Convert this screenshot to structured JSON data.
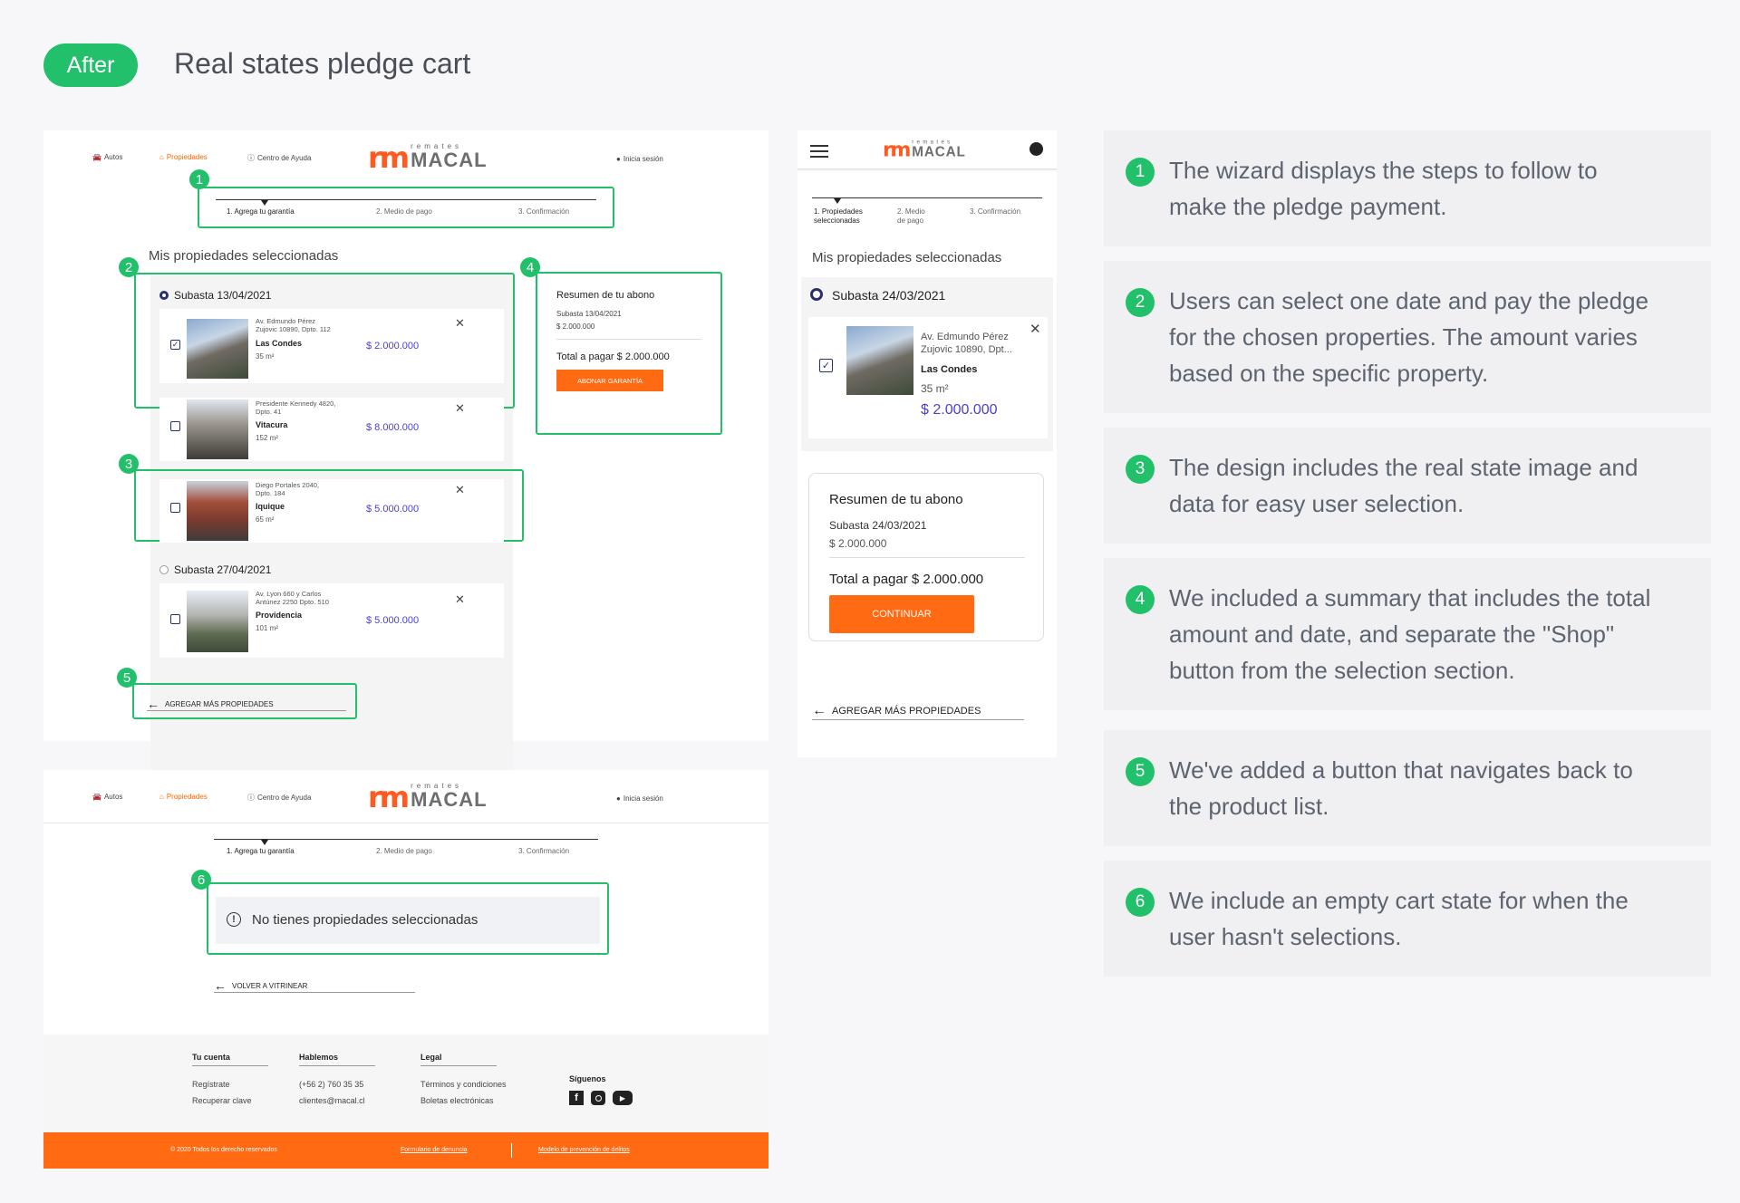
{
  "header": {
    "badge": "After",
    "title": "Real states pledge cart"
  },
  "nav": {
    "autos": "Autos",
    "propiedades": "Propiedades",
    "ayuda": "Centro de Ayuda",
    "login": "Inicia sesión",
    "logo_small": "remates",
    "logo_big": "MACAL",
    "logo_mark": "rm"
  },
  "steps": {
    "desktop": [
      "1. Agrega tu garantía",
      "2. Medio de pago",
      "3. Confirmación"
    ],
    "mobile": [
      [
        "1. Propiedades",
        "seleccionadas"
      ],
      [
        "2. Medio",
        "de pago"
      ],
      [
        "3. Confirmación"
      ]
    ]
  },
  "badges": [
    "1",
    "2",
    "3",
    "4",
    "5",
    "6"
  ],
  "desktop": {
    "section_title": "Mis propiedades seleccionadas",
    "auctions": [
      {
        "label": "Subasta 13/04/2021",
        "items": [
          {
            "addr1": "Av. Edmundo Pérez",
            "addr2": "Zujovic 10890, Dpto. 112",
            "city": "Las Condes",
            "area": "35 m²",
            "price": "$ 2.000.000",
            "checked": true
          },
          {
            "addr1": "Presidente Kennedy 4820,",
            "addr2": "Dpto. 41",
            "city": "Vitacura",
            "area": "152 m²",
            "price": "$ 8.000.000",
            "checked": false
          },
          {
            "addr1": "Diego Portales 2040,",
            "addr2": "Dpto. 184",
            "city": "Iquique",
            "area": "65 m²",
            "price": "$ 5.000.000",
            "checked": false
          }
        ]
      },
      {
        "label": "Subasta 27/04/2021",
        "items": [
          {
            "addr1": "Av. Lyon 660 y Carlos",
            "addr2": "Antúnez 2250 Dpto. 510",
            "city": "Providencia",
            "area": "101 m²",
            "price": "$ 5.000.000",
            "checked": false
          }
        ]
      }
    ],
    "summary": {
      "title": "Resumen de tu abono",
      "auction": "Subasta 13/04/2021",
      "amount": "$ 2.000.000",
      "total": "Total a pagar $ 2.000.000",
      "button": "ABONAR GARANTÍA"
    },
    "add_more": "AGREGAR MÁS PROPIEDADES"
  },
  "empty": {
    "message": "No tienes propiedades seleccionadas",
    "back": "VOLVER A VITRINEAR"
  },
  "footer": {
    "cols": [
      {
        "head": "Tu cuenta",
        "items": [
          "Regístrate",
          "Recuperar clave"
        ]
      },
      {
        "head": "Hablemos",
        "items": [
          "(+56 2) 760 35 35",
          "clientes@macal.cl"
        ]
      },
      {
        "head": "Legal",
        "items": [
          "Términos y condiciones",
          "Boletas  electrónicas"
        ]
      }
    ],
    "follow": "Síguenos",
    "copyright": "2020 Todos los derecho reservados",
    "link1": "Formulario de denuncia",
    "link2": "Modelo de prevención de delitos"
  },
  "mobile": {
    "section_title": "Mis propiedades seleccionadas",
    "auction": "Subasta 24/03/2021",
    "item": {
      "addr1": "Av. Edmundo Pérez",
      "addr2": "Zujovic 10890, Dpt...",
      "city": "Las Condes",
      "area": "35 m²",
      "price": "$ 2.000.000"
    },
    "summary": {
      "title": "Resumen de tu abono",
      "auction": "Subasta 24/03/2021",
      "amount": "$ 2.000.000",
      "total": "Total a pagar $ 2.000.000",
      "button": "CONTINUAR"
    },
    "add_more": "AGREGAR MÁS PROPIEDADES"
  },
  "notes": [
    {
      "n": "1",
      "lines": [
        "The wizard displays the steps to follow to",
        "make the pledge payment."
      ]
    },
    {
      "n": "2",
      "lines": [
        "Users can select one date and pay the pledge",
        "for the chosen properties. The amount varies",
        "based on the specific property."
      ]
    },
    {
      "n": "3",
      "lines": [
        "The design includes the real state image and",
        "data for easy user selection."
      ]
    },
    {
      "n": "4",
      "lines": [
        "We included a summary that includes the total",
        "amount and date, and separate the \"Shop\"",
        "button from the selection section."
      ]
    },
    {
      "n": "5",
      "lines": [
        "We've added a button that navigates back to",
        "the product list."
      ]
    },
    {
      "n": "6",
      "lines": [
        "We include an empty cart state for when the",
        "user hasn't selections."
      ]
    }
  ],
  "colors": {
    "accent_green": "#22c06a",
    "brand_orange": "#ff6a13",
    "price_purple": "#4b3fd1",
    "navy": "#28306e"
  }
}
